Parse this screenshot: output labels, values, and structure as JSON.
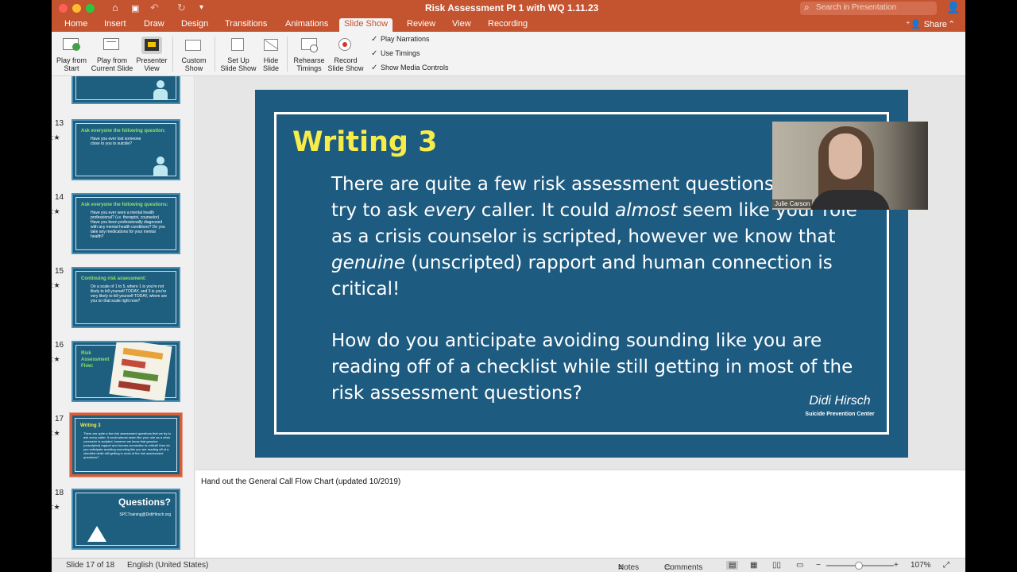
{
  "titlebar": {
    "doc_title": "Risk Assessment Pt 1 with WQ 1.11.23",
    "search_placeholder": "Search in Presentation"
  },
  "tabs": [
    "Home",
    "Insert",
    "Draw",
    "Design",
    "Transitions",
    "Animations",
    "Slide Show",
    "Review",
    "View",
    "Recording"
  ],
  "active_tab": "Slide Show",
  "share_label": "Share",
  "ribbon": {
    "play_from_start": "Play from\nStart",
    "play_from_current": "Play from\nCurrent Slide",
    "presenter_view": "Presenter\nView",
    "custom_show": "Custom\nShow",
    "setup_show": "Set Up\nSlide Show",
    "hide_slide": "Hide\nSlide",
    "rehearse": "Rehearse\nTimings",
    "record": "Record\nSlide Show",
    "play_narrations": "Play Narrations",
    "use_timings": "Use Timings",
    "show_media_controls": "Show Media Controls"
  },
  "thumbnails": [
    {
      "num": "13",
      "title": "Ask everyone the following question:",
      "text": "Have you ever lost someone close to you to suicide?"
    },
    {
      "num": "14",
      "title": "Ask everyone the following questions:",
      "text": "Have you ever seen a mental health professional? (i.e. therapist, counselor)  Have you been professionally diagnosed with any mental health conditions?  Do you take any medications for your mental health?"
    },
    {
      "num": "15",
      "title": "Continuing risk assessment:",
      "text": "On a scale of 1 to 5, where 1 is you're not likely to kill yourself TODAY, and 5 is you're very likely to kill yourself TODAY, where are you on that scale right now?"
    },
    {
      "num": "16",
      "title": "Risk Assessment Flow:",
      "text": ""
    },
    {
      "num": "17",
      "title": "Writing 3",
      "text": "There are quite a few risk assessment questions that we try to ask every caller. It could almost seem like your role as a crisis counselor is scripted, however we know that genuine (unscripted) rapport and human connection is critical!  How do you anticipate avoiding sounding like you are reading off of a checklist while still getting in most of the risk assessment questions?"
    },
    {
      "num": "18",
      "title": "Questions?",
      "text": "SPCTraining@DidiHirsch.org"
    }
  ],
  "slide": {
    "title": "Writing 3",
    "p1_a": "There are quite a few risk assessment questions that we try to ask ",
    "p1_every": "every",
    "p1_b": " caller. It could ",
    "p1_almost": "almost",
    "p1_c": " seem like your role as a crisis counselor is scripted, however we know that ",
    "p1_genuine": "genuine",
    "p1_d": " (unscripted) rapport and human connection is critical!",
    "p2": "How do you anticipate avoiding sounding like you are reading off of a checklist while still getting in most of the risk assessment questions?",
    "logo_name": "Didi Hirsch",
    "logo_sub": "Suicide Prevention Center"
  },
  "video": {
    "participant": "Julie Carson"
  },
  "notes": {
    "text": "Hand out the General Call Flow Chart (updated 10/2019)"
  },
  "status": {
    "slide_info": "Slide 17 of 18",
    "language": "English (United States)",
    "notes_label": "Notes",
    "comments_label": "Comments",
    "zoom": "107%"
  }
}
